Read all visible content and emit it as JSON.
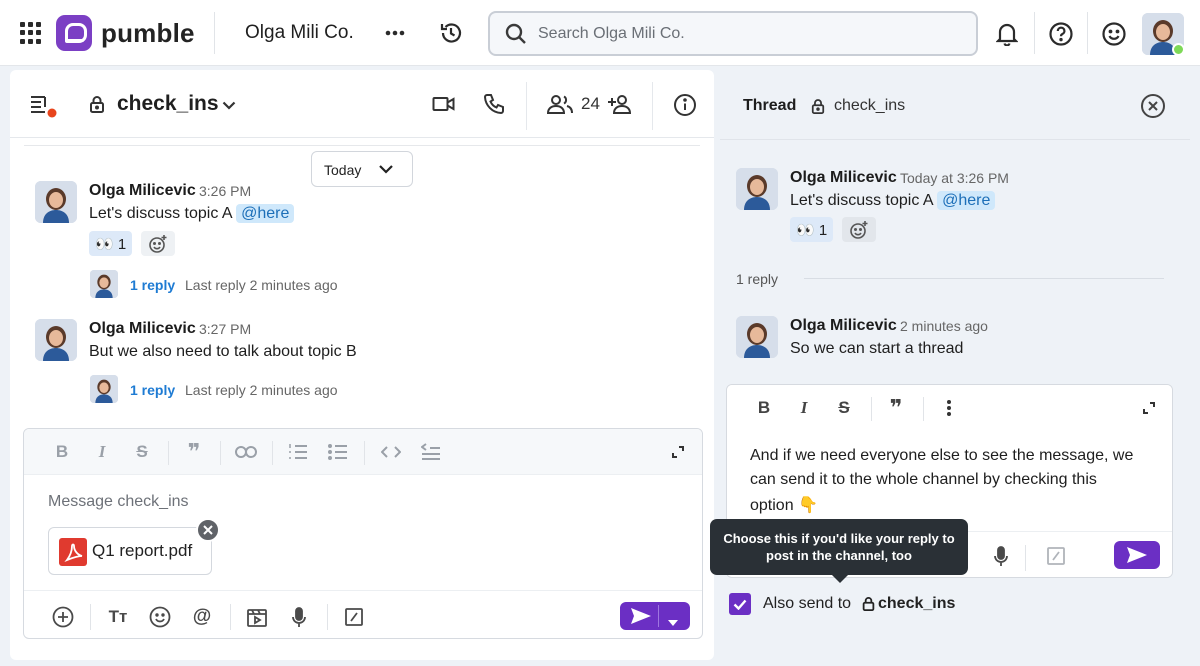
{
  "app": {
    "name": "pumble",
    "workspace": "Olga Mili Co."
  },
  "search": {
    "placeholder": "Search Olga Mili Co."
  },
  "channel": {
    "name": "check_ins",
    "members": "24"
  },
  "date_divider": "Today",
  "messages": [
    {
      "author": "Olga Milicevic",
      "time": "3:26 PM",
      "text": "Let's discuss topic A",
      "mention": "@here",
      "reaction": "👀 1",
      "reply_link": "1 reply",
      "reply_meta": "Last reply 2 minutes ago"
    },
    {
      "author": "Olga Milicevic",
      "time": "3:27 PM",
      "text": "But we also need to talk about topic B",
      "reply_link": "1 reply",
      "reply_meta": "Last reply 2 minutes ago"
    }
  ],
  "composer": {
    "placeholder": "Message check_ins",
    "attachment": "Q1 report.pdf"
  },
  "thread": {
    "title": "Thread",
    "channel": "check_ins",
    "parent": {
      "author": "Olga Milicevic",
      "time": "Today at 3:26 PM",
      "text": "Let's discuss topic A",
      "mention": "@here",
      "reaction": "👀 1"
    },
    "reply_count": "1 reply",
    "reply": {
      "author": "Olga Milicevic",
      "time": "2 minutes ago",
      "text": "So we can start a thread"
    },
    "draft_line1": "And if we need everyone else to see the message, we",
    "draft_line2": "can send it to the whole channel by checking this",
    "draft_line3": "option 👇",
    "tooltip_line1": "Choose this if you'd like your reply to",
    "tooltip_line2": "post in the channel, too",
    "also_send_label": "Also send to",
    "also_send_channel": "check_ins"
  },
  "colors": {
    "brand": "#6b2fc4",
    "mention_bg": "#cfe8fb",
    "link": "#1e7bd3"
  }
}
